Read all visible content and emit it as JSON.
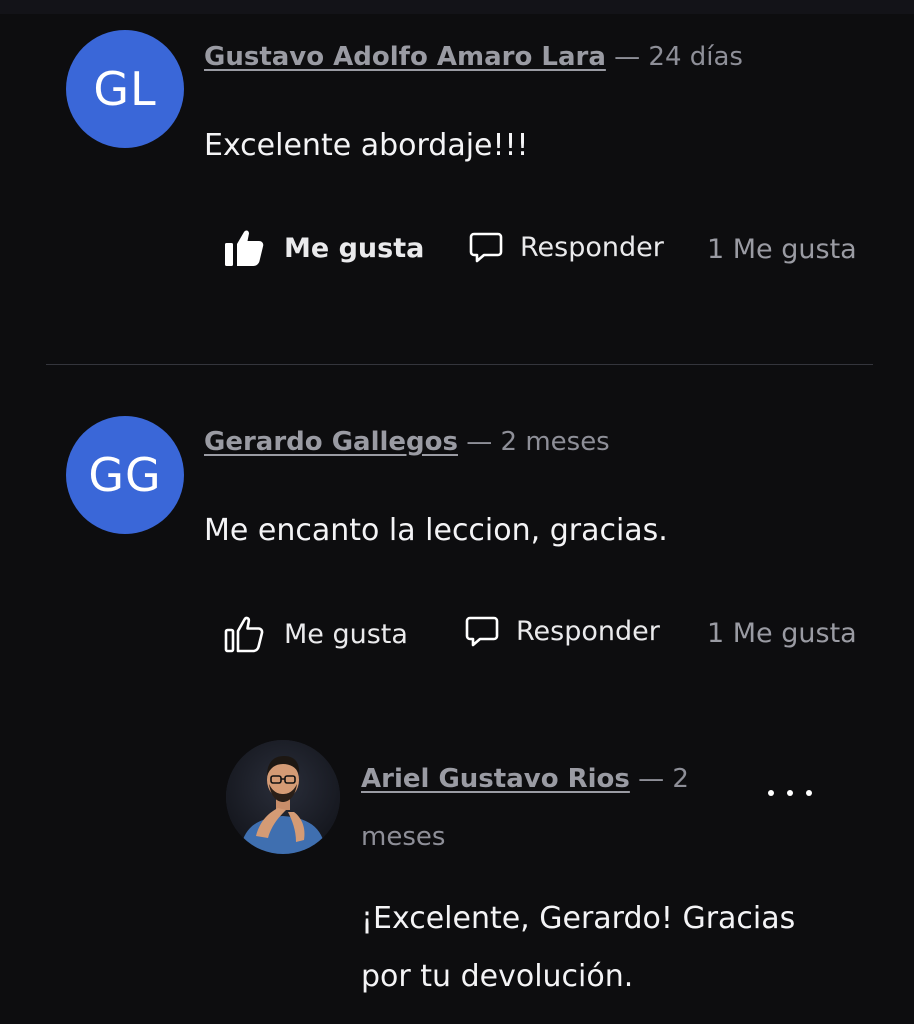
{
  "comments": [
    {
      "initials": "GL",
      "author": "Gustavo Adolfo Amaro Lara",
      "time": " — 24 días",
      "text": "Excelente abordaje!!!",
      "like_label": "Me gusta",
      "reply_label": "Responder",
      "likes_count": "1 Me gusta",
      "liked": true
    },
    {
      "initials": "GG",
      "author": "Gerardo Gallegos",
      "time": " — 2 meses",
      "text": "Me encanto la leccion, gracias.",
      "like_label": "Me gusta",
      "reply_label": "Responder",
      "likes_count": "1 Me gusta",
      "liked": false,
      "replies": [
        {
          "author": "Ariel Gustavo Rios",
          "time": " — 2 meses",
          "text": "¡Excelente, Gerardo! Gracias por tu devolución."
        }
      ]
    }
  ],
  "colors": {
    "background": "#0d0d0f",
    "avatar": "#3a67d8",
    "muted": "#9a9ba3",
    "text": "#f4f4f6"
  },
  "icons": {
    "like_filled": "thumbs-up-filled-icon",
    "like_outline": "thumbs-up-outline-icon",
    "reply": "speech-bubble-icon",
    "more": "more-horizontal-icon"
  }
}
